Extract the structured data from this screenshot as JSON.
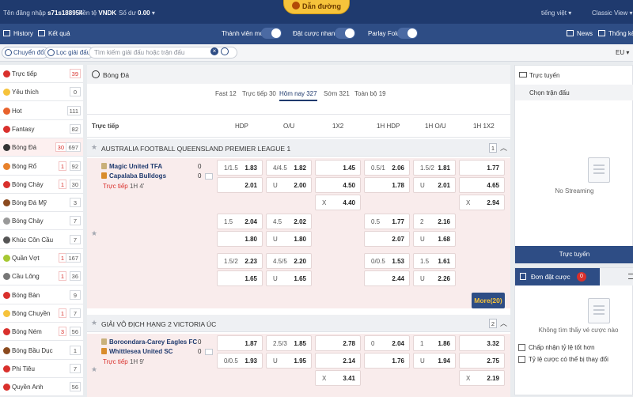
{
  "topbar": {
    "login_label": "Tên đăng nhập",
    "username": "s71s188954",
    "currency_label": "Tiền tệ",
    "currency": "VNDK",
    "balance_label": "Số dư",
    "balance": "0.00",
    "logo_text": "Dẫn đường",
    "language": "tiếng việt",
    "view_mode": "Classic View"
  },
  "navbar": {
    "history": "History",
    "results": "Kết quả",
    "new_member": "Thành viên mới",
    "quick_bet": "Đặt cược nhanh",
    "parlay_fold": "Parlay Fold",
    "news": "News",
    "stats": "Thống kê"
  },
  "filterbar": {
    "switch": "Chuyển đổi",
    "filter": "Lọc giải đấu",
    "search_placeholder": "Tìm kiếm giải đấu hoặc trận đấu",
    "odds_format": "EU"
  },
  "sidebar": [
    {
      "label": "Trực tiếp",
      "live": "",
      "count": "39",
      "color": "#d9302c",
      "count_red": true
    },
    {
      "label": "Yêu thích",
      "live": "",
      "count": "0",
      "color": "#f6c33b"
    },
    {
      "label": "Hot",
      "live": "",
      "count": "111",
      "color": "#e8622c"
    },
    {
      "label": "Fantasy",
      "live": "",
      "count": "82",
      "color": "#d9302c"
    },
    {
      "label": "Bóng Đá",
      "live": "30",
      "count": "697",
      "color": "#333333",
      "active": true
    },
    {
      "label": "Bóng Rổ",
      "live": "1",
      "count": "92",
      "color": "#e8822c"
    },
    {
      "label": "Bóng Chày",
      "live": "1",
      "count": "30",
      "color": "#d9302c"
    },
    {
      "label": "Bóng Đá Mỹ",
      "live": "",
      "count": "3",
      "color": "#8b4a1e"
    },
    {
      "label": "Bóng Chày",
      "live": "",
      "count": "7",
      "color": "#999999"
    },
    {
      "label": "Khúc Côn Cầu",
      "live": "",
      "count": "7",
      "color": "#555555"
    },
    {
      "label": "Quần Vợt",
      "live": "1",
      "count": "167",
      "color": "#a6c832"
    },
    {
      "label": "Cầu Lông",
      "live": "1",
      "count": "36",
      "color": "#777777"
    },
    {
      "label": "Bóng Bàn",
      "live": "",
      "count": "9",
      "color": "#d9302c"
    },
    {
      "label": "Bóng Chuyền",
      "live": "1",
      "count": "7",
      "color": "#f6c33b"
    },
    {
      "label": "Bóng Ném",
      "live": "3",
      "count": "56",
      "color": "#d9302c"
    },
    {
      "label": "Bóng Bầu Dục",
      "live": "",
      "count": "1",
      "color": "#8b4a1e"
    },
    {
      "label": "Phi Tiêu",
      "live": "",
      "count": "7",
      "color": "#d9302c"
    },
    {
      "label": "Quyền Anh",
      "live": "",
      "count": "56",
      "color": "#d9302c"
    }
  ],
  "main": {
    "sport_title": "Bóng Đá",
    "tabs": [
      "Fast 12",
      "Trực tiếp 30",
      "Hôm nay 327",
      "Sớm 321",
      "Toàn bộ 19"
    ],
    "selected_tab": 2,
    "columns": [
      "Trực tiếp",
      "HDP",
      "O/U",
      "1X2",
      "1H HDP",
      "1H O/U",
      "1H 1X2"
    ],
    "more_label": "More",
    "more_count": "(20)"
  },
  "leagues": [
    {
      "name": "AUSTRALIA FOOTBALL QUEENSLAND PREMIER LEAGUE 1",
      "count": "1",
      "home": "Magic United TFA",
      "away": "Capalaba Bulldogs",
      "home_score": "0",
      "away_score": "0",
      "live_label": "Trực tiếp",
      "time": "1H 4'",
      "rows": [
        [
          "1/1.5",
          "1.83",
          "4/4.5",
          "1.82",
          "",
          "1.45",
          "0.5/1",
          "2.06",
          "1.5/2",
          "1.81",
          "",
          "1.77"
        ],
        [
          "",
          "2.01",
          "U",
          "2.00",
          "",
          "4.50",
          "",
          "1.78",
          "U",
          "2.01",
          "",
          "4.65"
        ],
        [
          "",
          "",
          "",
          "",
          "X",
          "4.40",
          "",
          "",
          "",
          "",
          "X",
          "2.94"
        ],
        [
          "1.5",
          "2.04",
          "4.5",
          "2.02",
          "",
          "",
          "0.5",
          "1.77",
          "2",
          "2.16",
          "",
          ""
        ],
        [
          "",
          "1.80",
          "U",
          "1.80",
          "",
          "",
          "",
          "2.07",
          "U",
          "1.68",
          "",
          ""
        ],
        [
          "1.5/2",
          "2.23",
          "4.5/5",
          "2.20",
          "",
          "",
          "0/0.5",
          "1.53",
          "1.5",
          "1.61",
          "",
          ""
        ],
        [
          "",
          "1.65",
          "U",
          "1.65",
          "",
          "",
          "",
          "2.44",
          "U",
          "2.26",
          "",
          ""
        ]
      ]
    },
    {
      "name": "GIẢI VÔ ĐỊCH HẠNG 2 VICTORIA ÚC",
      "count": "2",
      "home": "Boroondara-Carey Eagles FC",
      "away": "Whittlesea United SC",
      "home_score": "0",
      "away_score": "0",
      "live_label": "Trực tiếp",
      "time": "1H 9'",
      "rows": [
        [
          "",
          "1.87",
          "2.5/3",
          "1.85",
          "",
          "2.78",
          "0",
          "2.04",
          "1",
          "1.86",
          "",
          "3.32"
        ],
        [
          "0/0.5",
          "1.93",
          "U",
          "1.95",
          "",
          "2.14",
          "",
          "1.76",
          "U",
          "1.94",
          "",
          "2.75"
        ],
        [
          "",
          "",
          "",
          "",
          "X",
          "3.41",
          "",
          "",
          "",
          "",
          "X",
          "2.19"
        ]
      ]
    }
  ],
  "right": {
    "live_title": "Trực tuyến",
    "choose_match": "Chọn trận đấu",
    "no_streaming": "No Streaming",
    "live_button": "Trực tuyến",
    "bet_slip": "Đơn đặt cược",
    "bet_count": "0",
    "no_bets": "Không tìm thấy vé cược nào",
    "accept_better": "Chấp nhận tỷ lệ tốt hơn",
    "odds_may_change": "Tỷ lệ cược có thể bị thay đổi"
  }
}
